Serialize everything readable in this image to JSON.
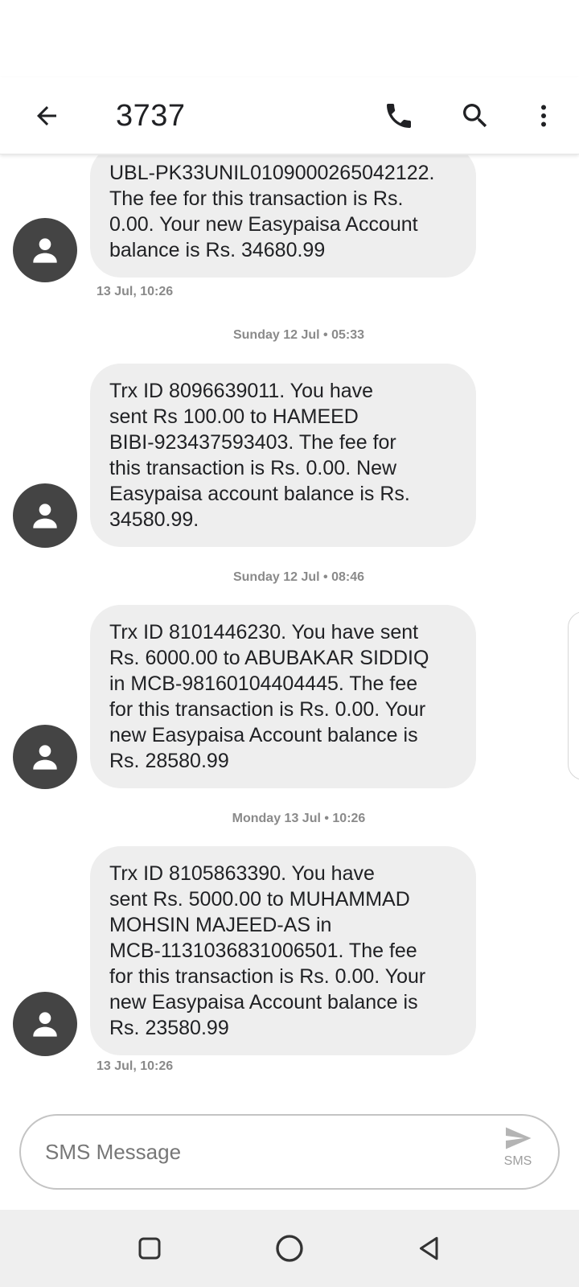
{
  "header": {
    "title": "3737",
    "icons": {
      "back": "arrow-back-icon",
      "call": "phone-icon",
      "search": "search-icon",
      "more": "more-vert-icon"
    }
  },
  "messages": [
    {
      "text": "UBL-PK33UNIL0109000265042122.\nThe fee for this transaction is Rs.\n0.00. Your new Easypaisa Account\nbalance is Rs. 34680.99",
      "meta": "13 Jul, 10:26"
    },
    {
      "date_divider": "Sunday 12 Jul • 05:33",
      "text": "Trx ID 8096639011. You have\nsent Rs 100.00 to HAMEED\nBIBI-923437593403. The  fee for\nthis transaction is Rs. 0.00. New\nEasypaisa account balance is Rs.\n34580.99."
    },
    {
      "date_divider": "Sunday 12 Jul • 08:46",
      "text": "Trx ID 8101446230. You have sent\nRs. 6000.00 to ABUBAKAR SIDDIQ\nin MCB-98160104404445. The fee\nfor this transaction is Rs. 0.00. Your\nnew Easypaisa Account balance is\nRs. 28580.99"
    },
    {
      "date_divider": "Monday 13 Jul • 10:26",
      "text": "Trx ID 8105863390. You have\nsent Rs. 5000.00 to MUHAMMAD\nMOHSIN MAJEED-AS in\nMCB-1131036831006501. The fee\nfor this transaction is Rs. 0.00. Your\nnew Easypaisa Account balance is\nRs. 23580.99",
      "meta": "13 Jul, 10:26"
    }
  ],
  "compose": {
    "placeholder": "SMS Message",
    "send_label": "SMS"
  },
  "colors": {
    "bubble": "#eeeeee",
    "avatar": "#444444",
    "meta_text": "#8a8a8a",
    "nav_bar": "#efefef"
  }
}
